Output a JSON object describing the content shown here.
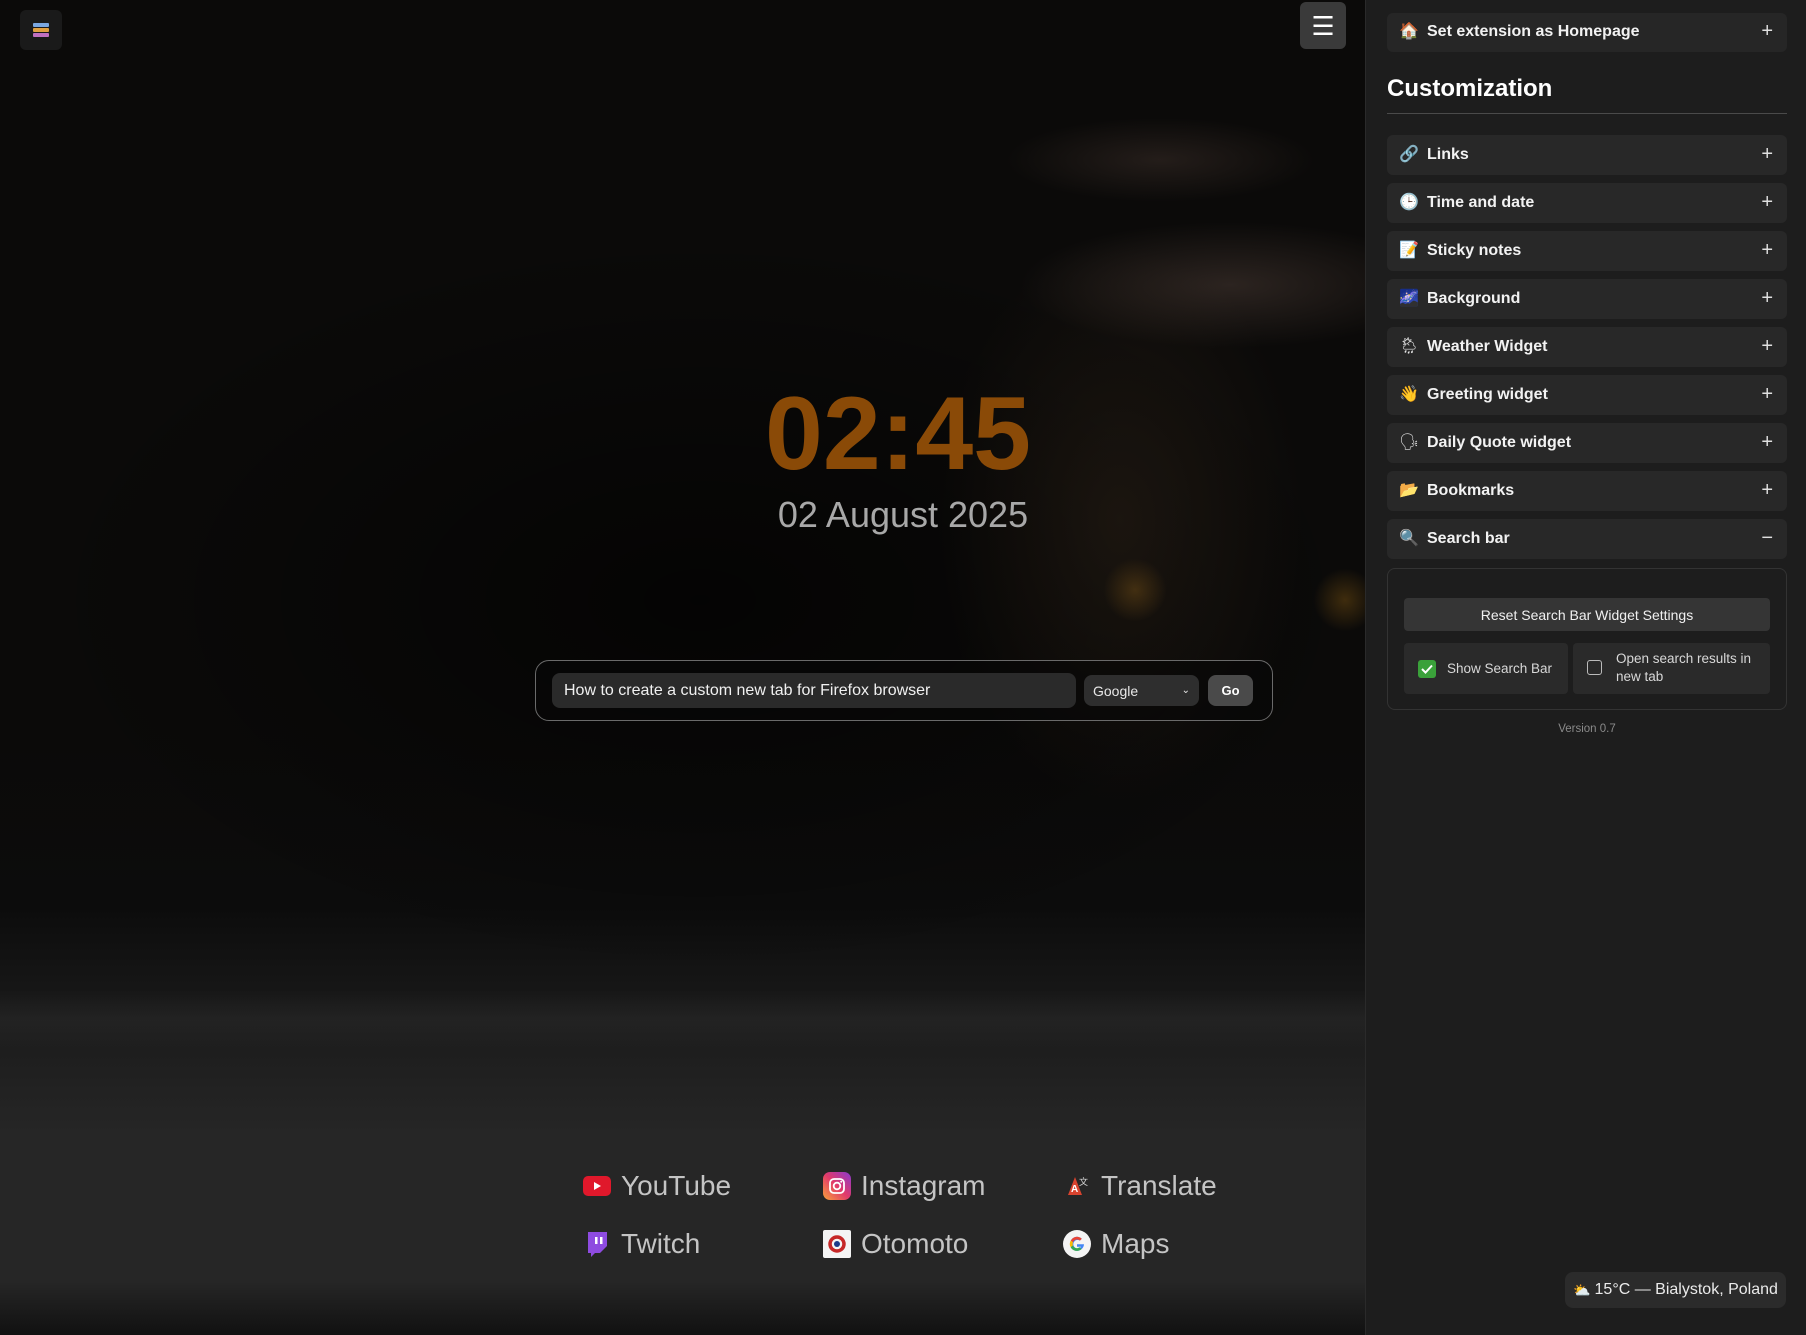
{
  "clock": {
    "time": "02:45",
    "date": "02 August 2025",
    "color": "#8a4a07"
  },
  "search": {
    "query": "How to create a custom new tab for Firefox browser",
    "engine": "Google",
    "go_label": "Go"
  },
  "links": [
    {
      "label": "YouTube",
      "icon": "youtube-icon"
    },
    {
      "label": "Instagram",
      "icon": "instagram-icon"
    },
    {
      "label": "Translate",
      "icon": "translate-icon"
    },
    {
      "label": "Twitch",
      "icon": "twitch-icon"
    },
    {
      "label": "Otomoto",
      "icon": "otomoto-icon"
    },
    {
      "label": "Maps",
      "icon": "maps-icon"
    }
  ],
  "sidebar": {
    "homepage": {
      "label": "Set extension as Homepage",
      "icon": "house-icon",
      "toggle": "+"
    },
    "title": "Customization",
    "sections": [
      {
        "label": "Links",
        "icon": "link-icon",
        "toggle": "+"
      },
      {
        "label": "Time and date",
        "icon": "clock-icon",
        "toggle": "+"
      },
      {
        "label": "Sticky notes",
        "icon": "memo-icon",
        "toggle": "+"
      },
      {
        "label": "Background",
        "icon": "image-icon",
        "toggle": "+"
      },
      {
        "label": "Weather Widget",
        "icon": "cloud-rain-icon",
        "toggle": "+"
      },
      {
        "label": "Greeting widget",
        "icon": "waving-hand-icon",
        "toggle": "+"
      },
      {
        "label": "Daily Quote widget",
        "icon": "speaking-head-icon",
        "toggle": "+"
      },
      {
        "label": "Bookmarks",
        "icon": "folder-icon",
        "toggle": "+"
      },
      {
        "label": "Search bar",
        "icon": "magnifier-icon",
        "toggle": "−"
      }
    ],
    "search_panel": {
      "reset_label": "Reset Search Bar Widget Settings",
      "show_search_label": "Show Search Bar",
      "show_search_checked": true,
      "new_tab_label": "Open search results in new tab",
      "new_tab_checked": false
    },
    "version": "Version 0.7"
  },
  "weather": {
    "text": "15°C — Bialystok, Poland",
    "icon": "sun-cloud-icon"
  }
}
